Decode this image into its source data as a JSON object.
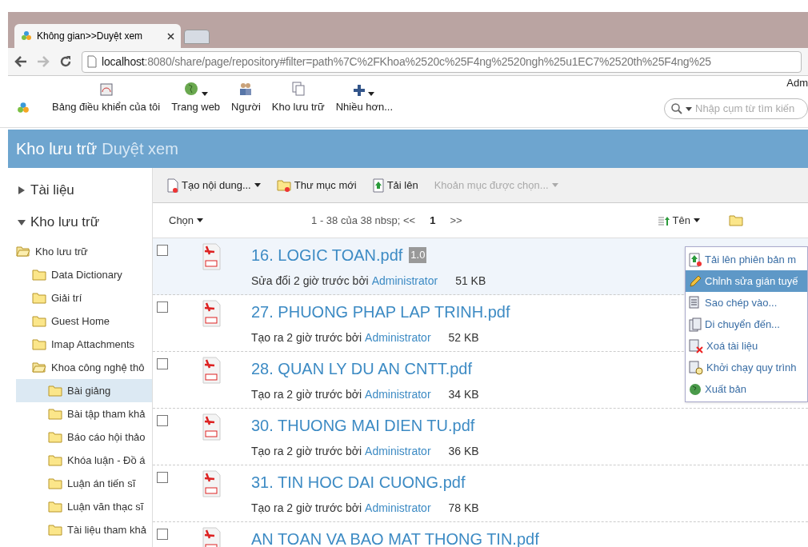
{
  "browser": {
    "tab_title": "Không gian>>Duyệt xem",
    "url_host": "localhost",
    "url_rest": ":8080/share/page/repository#filter=path%7C%2FKhoa%2520c%25F4ng%2520ngh%25u1EC7%2520th%25F4ng%25"
  },
  "header": {
    "nav": [
      {
        "label": "Bảng điều khiển của tôi",
        "kind": "dashboard",
        "dropdown": false
      },
      {
        "label": "Trang web",
        "kind": "globe",
        "dropdown": true
      },
      {
        "label": "Người",
        "kind": "people",
        "dropdown": false
      },
      {
        "label": "Kho lưu trữ",
        "kind": "docs",
        "dropdown": false
      },
      {
        "label": "Nhiều hơn...",
        "kind": "plus",
        "dropdown": true
      }
    ],
    "user": "Adm",
    "search": {
      "placeholder": "Nhập cụm từ tìm kiến"
    }
  },
  "title": {
    "main": "Kho lưu trữ",
    "sub": "Duyệt xem"
  },
  "sidebar": {
    "sections": [
      {
        "label": "Tài liệu",
        "expanded": false
      },
      {
        "label": "Kho lưu trữ",
        "expanded": true
      }
    ],
    "tree": [
      {
        "label": "Kho lưu trữ",
        "expanded": true,
        "selected": false,
        "children": [
          {
            "label": "Data Dictionary",
            "expanded": false,
            "selected": false
          },
          {
            "label": "Giải trí",
            "expanded": false,
            "selected": false
          },
          {
            "label": "Guest Home",
            "expanded": false,
            "selected": false
          },
          {
            "label": "Imap Attachments",
            "expanded": false,
            "selected": false
          },
          {
            "label": "Khoa công nghệ thô",
            "expanded": true,
            "selected": false,
            "children": [
              {
                "label": "Bài giảng",
                "expanded": false,
                "selected": true
              },
              {
                "label": "Bài tập tham khả",
                "expanded": false,
                "selected": false
              },
              {
                "label": "Báo cáo hội thảo",
                "expanded": false,
                "selected": false
              },
              {
                "label": "Khóa luận - Đồ á",
                "expanded": false,
                "selected": false
              },
              {
                "label": "Luận án tiến sĩ",
                "expanded": false,
                "selected": false
              },
              {
                "label": "Luận văn thạc sĩ",
                "expanded": false,
                "selected": false
              },
              {
                "label": "Tài liệu tham khả",
                "expanded": false,
                "selected": false
              }
            ]
          }
        ]
      }
    ]
  },
  "toolbar": [
    {
      "label": "Tạo nội dung...",
      "kind": "new-doc",
      "dropdown": true,
      "disabled": false
    },
    {
      "label": "Thư mục mới",
      "kind": "new-folder",
      "dropdown": false,
      "disabled": false
    },
    {
      "label": "Tải lên",
      "kind": "upload",
      "dropdown": false,
      "disabled": false
    },
    {
      "label": "Khoản mục được chọn...",
      "kind": "plain",
      "dropdown": true,
      "disabled": true
    }
  ],
  "list_bar": {
    "select": "Chọn",
    "paging": "1 - 38 của 38 nbsp; <<",
    "page": "1",
    "next": ">>",
    "sort": "Tên"
  },
  "files": [
    {
      "name": "16. LOGIC TOAN.pdf",
      "version": "1.0",
      "action": "Sửa đổi 2 giờ trước bởi",
      "user": "Administrator",
      "size": "51 KB",
      "checked": false,
      "selected": true
    },
    {
      "name": "27. PHUONG PHAP LAP TRINH.pdf",
      "action": "Tạo ra 2 giờ trước bởi",
      "user": "Administrator",
      "size": "52 KB",
      "checked": false,
      "selected": false
    },
    {
      "name": "28. QUAN LY DU AN CNTT.pdf",
      "action": "Tạo ra 2 giờ trước bởi",
      "user": "Administrator",
      "size": "34 KB",
      "checked": false,
      "selected": false
    },
    {
      "name": "30. THUONG MAI DIEN TU.pdf",
      "action": "Tạo ra 2 giờ trước bởi",
      "user": "Administrator",
      "size": "36 KB",
      "checked": false,
      "selected": false
    },
    {
      "name": "31. TIN HOC DAI CUONG.pdf",
      "action": "Tạo ra 2 giờ trước bởi",
      "user": "Administrator",
      "size": "78 KB",
      "checked": false,
      "selected": false
    },
    {
      "name": "AN TOAN VA BAO MAT THONG TIN.pdf",
      "checked": false,
      "selected": false
    }
  ],
  "menu": [
    {
      "label": "Tải lên phiên bản m",
      "kind": "upload",
      "selected": false
    },
    {
      "label": "Chỉnh sửa gián tuyế",
      "kind": "pencil",
      "selected": true
    },
    {
      "label": "Sao chép vào...",
      "kind": "copy",
      "selected": false
    },
    {
      "label": "Di chuyển đến...",
      "kind": "move",
      "selected": false
    },
    {
      "label": "Xoá tài liệu",
      "kind": "delete",
      "selected": false
    },
    {
      "label": "Khởi chạy quy trình",
      "kind": "workflow",
      "selected": false
    },
    {
      "label": "Xuất bản",
      "kind": "publish",
      "selected": false
    }
  ]
}
